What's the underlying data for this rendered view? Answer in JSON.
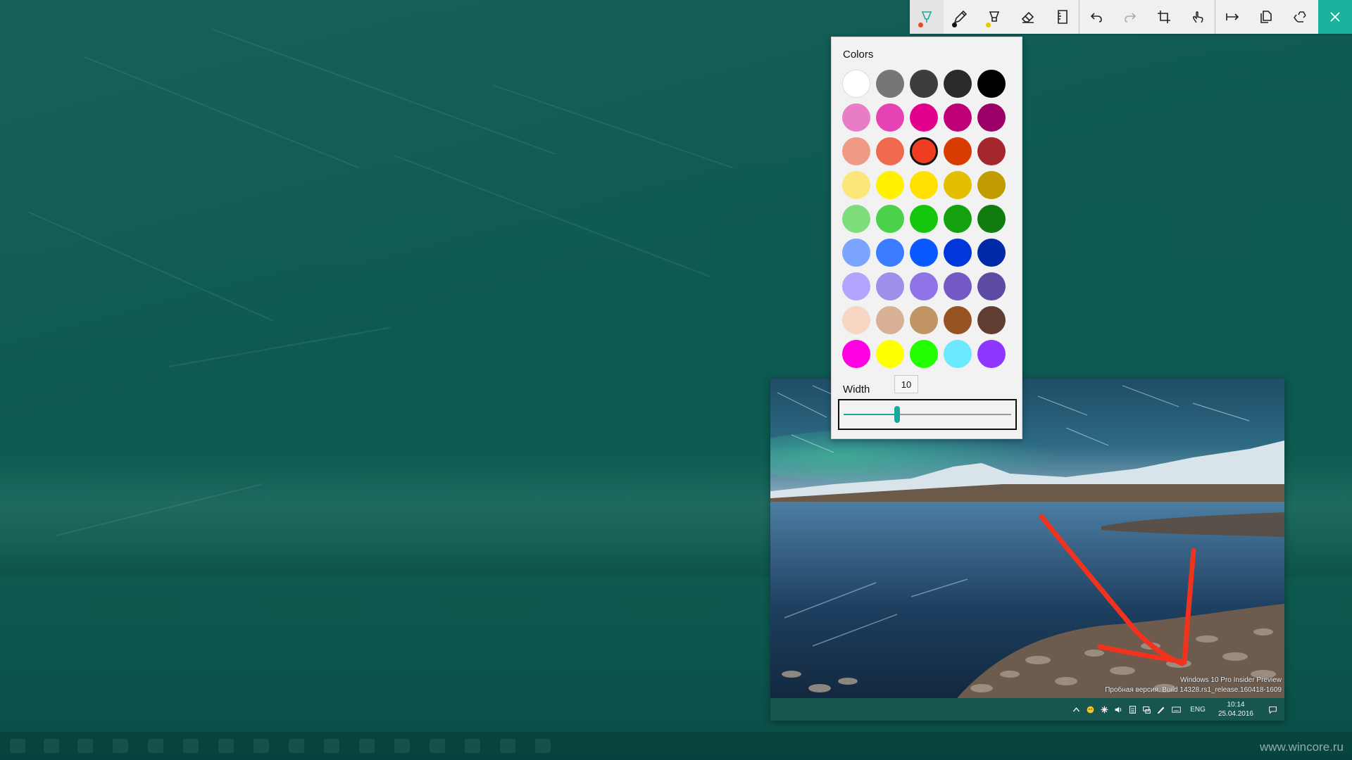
{
  "toolbar": {
    "tools": [
      {
        "name": "ballpoint-pen-icon",
        "dot": "#e04a2a",
        "active": true
      },
      {
        "name": "pencil-icon",
        "dot": "#111111"
      },
      {
        "name": "highlighter-icon",
        "dot": "#e8c800"
      },
      {
        "name": "eraser-icon"
      },
      {
        "name": "ruler-icon"
      },
      {
        "name": "undo-icon"
      },
      {
        "name": "redo-icon"
      },
      {
        "name": "crop-icon"
      },
      {
        "name": "touch-writing-icon"
      },
      {
        "name": "share-arrow-icon"
      },
      {
        "name": "copy-icon"
      },
      {
        "name": "save-icon"
      }
    ],
    "close_icon": "close-icon",
    "accent": "#1bb39d"
  },
  "colors_panel": {
    "title": "Colors",
    "swatches": [
      [
        "#ffffff",
        "#767676",
        "#3d3d3d",
        "#2b2b2b",
        "#000000"
      ],
      [
        "#e87cc7",
        "#e543b3",
        "#e3008c",
        "#bf0077",
        "#9a0068"
      ],
      [
        "#ef9a85",
        "#ef6950",
        "#f03c20",
        "#da3b01",
        "#a4262c"
      ],
      [
        "#fce67a",
        "#fff100",
        "#ffe000",
        "#e3bf00",
        "#c19c00"
      ],
      [
        "#7ddd7a",
        "#4cd24a",
        "#16c60c",
        "#13a10e",
        "#107c10"
      ],
      [
        "#7ba4ff",
        "#3a7bff",
        "#0a59ff",
        "#0037da",
        "#002aa8"
      ],
      [
        "#b4a4ff",
        "#a08fea",
        "#8e74e7",
        "#7458c4",
        "#5c4aa3"
      ],
      [
        "#f7d7c4",
        "#d8b094",
        "#c19463",
        "#985324",
        "#603d30"
      ],
      [
        "#ff00e0",
        "#ffff00",
        "#22ff00",
        "#6ce8ff",
        "#8e36ff"
      ]
    ],
    "selected": [
      2,
      2
    ],
    "width_label": "Width",
    "width_value": "10",
    "width_fraction": 0.32
  },
  "preview": {
    "os_text_line1": "Windows 10 Pro Insider Preview",
    "os_text_line2": "Пробная версия. Build 14328.rs1_release.160418-1609",
    "tray_icons": [
      "chevron-up-icon",
      "emoji-icon",
      "sync-icon",
      "volume-icon",
      "calculator-icon",
      "network-icon",
      "pen-icon",
      "keyboard-icon"
    ],
    "language": "ENG",
    "time": "10:14",
    "date": "25.04.2016",
    "notification_icon": "notification-icon",
    "arrow_color": "#f0321e"
  },
  "watermark": "www.wincore.ru"
}
